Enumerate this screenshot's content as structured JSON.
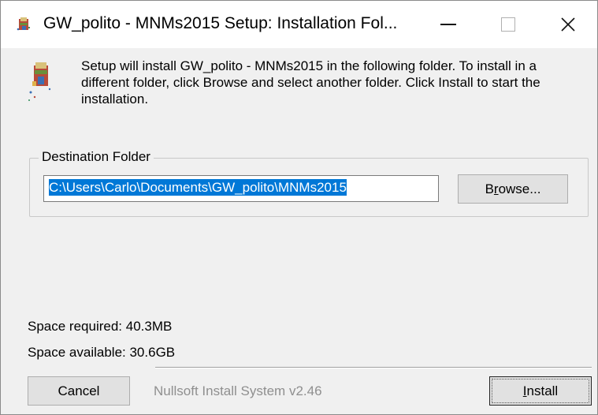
{
  "window": {
    "title": "GW_polito - MNMs2015 Setup: Installation Fol...",
    "app_icon": "installer-package-icon",
    "controls": {
      "minimize": "minimize-icon",
      "maximize": "maximize-icon",
      "close": "close-icon"
    }
  },
  "header": {
    "icon": "installer-package-icon",
    "text": "Setup will install GW_polito - MNMs2015 in the following folder. To install in a different folder, click Browse and select another folder. Click Install to start the installation."
  },
  "destination": {
    "group_label": "Destination Folder",
    "path_value": "C:\\Users\\Carlo\\Documents\\GW_polito\\MNMs2015",
    "browse_label_pre": "B",
    "browse_label_ul": "r",
    "browse_label_post": "owse..."
  },
  "space": {
    "required": "Space required: 40.3MB",
    "available": "Space available: 30.6GB"
  },
  "footer": {
    "branding": "Nullsoft Install System v2.46",
    "cancel_label": "Cancel",
    "install_label_ul": "I",
    "install_label_post": "nstall"
  },
  "colors": {
    "selection": "#0078d7",
    "dialog_bg": "#f0f0f0",
    "branding_text": "#8f8f8f"
  }
}
